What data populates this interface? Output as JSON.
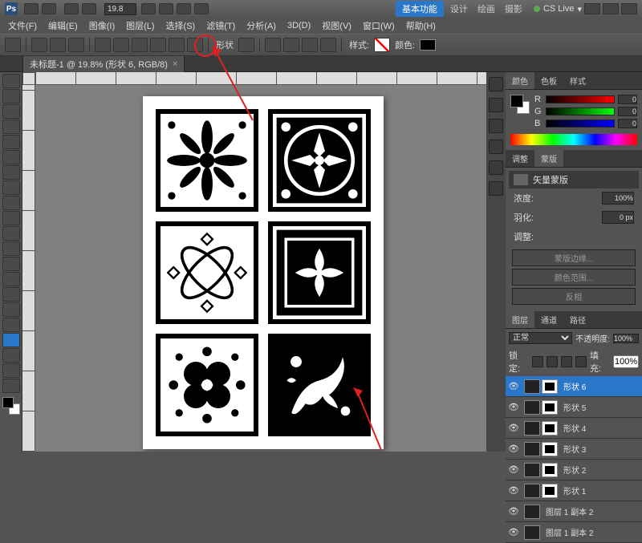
{
  "titlebar": {
    "logo": "Ps",
    "zoom": "19.8",
    "ws_active": "基本功能",
    "ws_tabs": [
      "设计",
      "绘画",
      "摄影"
    ],
    "cslive": "CS Live"
  },
  "menu": [
    "文件(F)",
    "编辑(E)",
    "图像(I)",
    "图层(L)",
    "选择(S)",
    "滤镜(T)",
    "分析(A)",
    "3D(D)",
    "视图(V)",
    "窗口(W)",
    "帮助(H)"
  ],
  "options": {
    "shape_label": "形状",
    "style_label": "样式:",
    "color_label": "颜色:"
  },
  "doctab": {
    "title": "未标题-1 @ 19.8% (形状 6, RGB/8)"
  },
  "panel_color": {
    "tabs": [
      "颜色",
      "色板",
      "样式"
    ],
    "r": "0",
    "g": "0",
    "b": "0"
  },
  "panel_mask": {
    "tabs": [
      "调整",
      "蒙版"
    ],
    "title": "矢量蒙版",
    "density_label": "浓度:",
    "density_value": "100%",
    "feather_label": "羽化:",
    "feather_value": "0 px",
    "refine_label": "调整:",
    "btn1": "蒙版边缘...",
    "btn2": "颜色范围...",
    "btn3": "反相"
  },
  "panel_layers": {
    "tabs": [
      "图层",
      "通道",
      "路径"
    ],
    "blend": "正常",
    "opacity_label": "不透明度:",
    "opacity": "100%",
    "lock_label": "锁定:",
    "fill_label": "填充:",
    "fill": "100%",
    "layers": [
      {
        "name": "形状 6",
        "sel": true
      },
      {
        "name": "形状 5"
      },
      {
        "name": "形状 4"
      },
      {
        "name": "形状 3"
      },
      {
        "name": "形状 2"
      },
      {
        "name": "形状 1"
      },
      {
        "name": "图层 1 副本 2"
      },
      {
        "name": "图层 1 副本 2"
      }
    ]
  }
}
